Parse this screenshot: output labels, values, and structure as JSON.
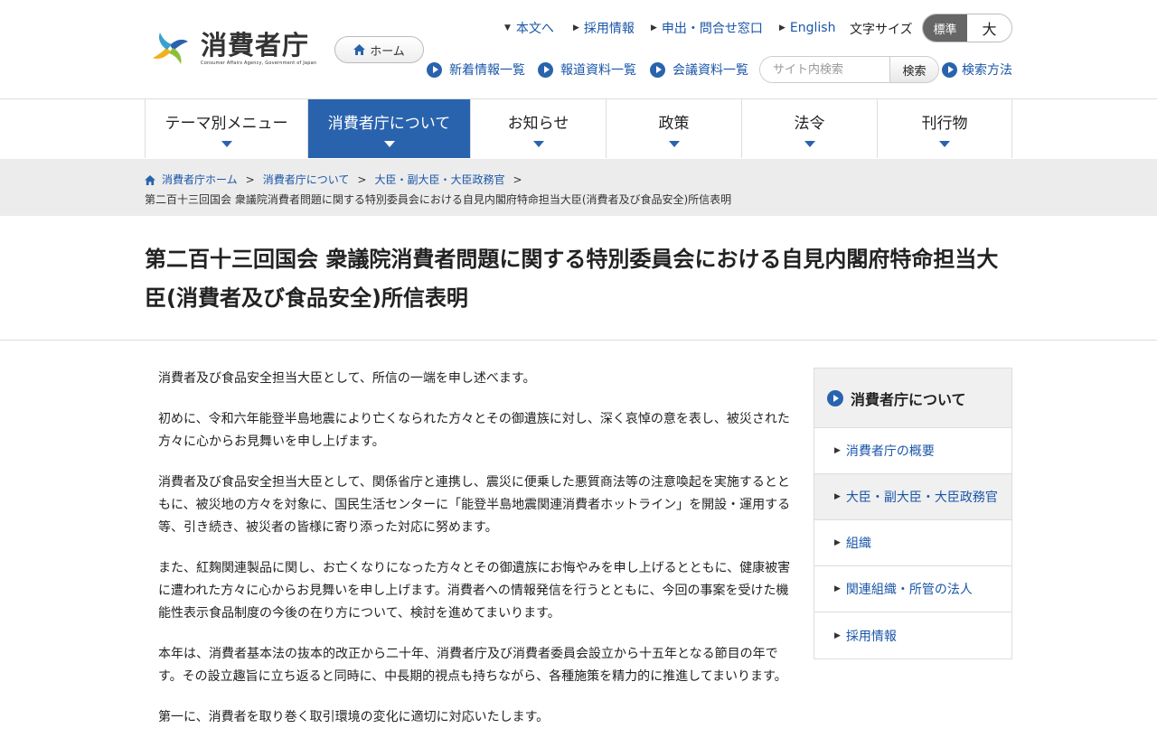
{
  "header": {
    "logo_name": "消費者庁",
    "logo_sub": "Consumer Affairs Agency, Government of Japan",
    "home_label": "ホーム",
    "utility_links": [
      "本文へ",
      "採用情報",
      "申出・問合せ窓口",
      "English"
    ],
    "font_size_label": "文字サイズ",
    "font_size_standard": "標準",
    "font_size_large": "大",
    "secondary_links": [
      "新着情報一覧",
      "報道資料一覧",
      "会議資料一覧"
    ],
    "search_placeholder": "サイト内検索",
    "search_button": "検索",
    "search_help": "検索方法"
  },
  "gnav": [
    {
      "label": "テーマ別メニュー"
    },
    {
      "label": "消費者庁について",
      "active": true
    },
    {
      "label": "お知らせ"
    },
    {
      "label": "政策"
    },
    {
      "label": "法令"
    },
    {
      "label": "刊行物"
    }
  ],
  "breadcrumb": {
    "items": [
      "消費者庁ホーム",
      "消費者庁について",
      "大臣・副大臣・大臣政務官"
    ],
    "current": "第二百十三回国会 衆議院消費者問題に関する特別委員会における自見内閣府特命担当大臣(消費者及び食品安全)所信表明"
  },
  "page_title": "第二百十三回国会 衆議院消費者問題に関する特別委員会における自見内閣府特命担当大臣(消費者及び食品安全)所信表明",
  "body_paragraphs": [
    "消費者及び食品安全担当大臣として、所信の一端を申し述べます。",
    "初めに、令和六年能登半島地震により亡くなられた方々とその御遺族に対し、深く哀悼の意を表し、被災された方々に心からお見舞いを申し上げます。",
    "消費者及び食品安全担当大臣として、関係省庁と連携し、震災に便乗した悪質商法等の注意喚起を実施するとともに、被災地の方々を対象に、国民生活センターに「能登半島地震関連消費者ホットライン」を開設・運用する等、引き続き、被災者の皆様に寄り添った対応に努めます。",
    "また、紅麹関連製品に関し、お亡くなりになった方々とその御遺族にお悔やみを申し上げるとともに、健康被害に遭われた方々に心からお見舞いを申し上げます。消費者への情報発信を行うとともに、今回の事案を受けた機能性表示食品制度の今後の在り方について、検討を進めてまいります。",
    "本年は、消費者基本法の抜本的改正から二十年、消費者庁及び消費者委員会設立から十五年となる節目の年です。その設立趣旨に立ち返ると同時に、中長期的視点も持ちながら、各種施策を精力的に推進してまいります。",
    "第一に、消費者を取り巻く取引環境の変化に適切に対応いたします。"
  ],
  "sidebar": {
    "heading": "消費者庁について",
    "items": [
      {
        "label": "消費者庁の概要"
      },
      {
        "label": "大臣・副大臣・大臣政務官",
        "current": true
      },
      {
        "label": "組織"
      },
      {
        "label": "関連組織・所管の法人"
      },
      {
        "label": "採用情報"
      }
    ]
  },
  "colors": {
    "accent": "#2a63ad",
    "link": "#1a56a8",
    "crumb_bg": "#ececec"
  }
}
